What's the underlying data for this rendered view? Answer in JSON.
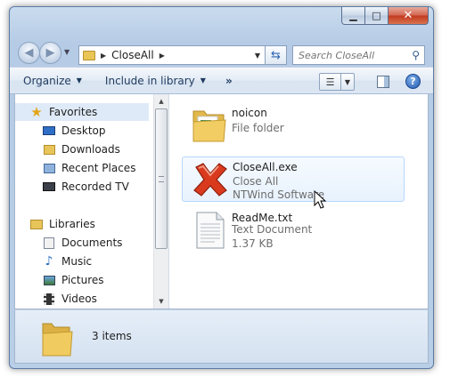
{
  "window": {
    "caption": {
      "minimize": "▁",
      "maximize": "□",
      "close": "✕"
    }
  },
  "address": {
    "path": [
      "CloseAll"
    ],
    "search_placeholder": "Search CloseAll"
  },
  "toolbar": {
    "organize": "Organize",
    "include_in_library": "Include in library",
    "more": "»",
    "help": "?"
  },
  "nav": {
    "favorites": {
      "label": "Favorites",
      "items": [
        {
          "label": "Desktop",
          "icon": "desktop-icon"
        },
        {
          "label": "Downloads",
          "icon": "downloads-icon"
        },
        {
          "label": "Recent Places",
          "icon": "recent-places-icon"
        },
        {
          "label": "Recorded TV",
          "icon": "recorded-tv-icon"
        }
      ]
    },
    "libraries": {
      "label": "Libraries",
      "items": [
        {
          "label": "Documents",
          "icon": "documents-icon"
        },
        {
          "label": "Music",
          "icon": "music-icon"
        },
        {
          "label": "Pictures",
          "icon": "pictures-icon"
        },
        {
          "label": "Videos",
          "icon": "videos-icon"
        }
      ]
    }
  },
  "files": [
    {
      "name": "noicon",
      "line1": "File folder",
      "line2": "",
      "icon": "folder-icon"
    },
    {
      "name": "CloseAll.exe",
      "line1": "Close All",
      "line2": "NTWind Software",
      "icon": "red-x-icon"
    },
    {
      "name": "ReadMe.txt",
      "line1": "Text Document",
      "line2": "1.37 KB",
      "icon": "text-document-icon"
    }
  ],
  "status": {
    "count": "3 items"
  },
  "colors": {
    "accent": "#2359ad",
    "hover_border": "#b8d6fb",
    "close_red": "#c2391e"
  }
}
